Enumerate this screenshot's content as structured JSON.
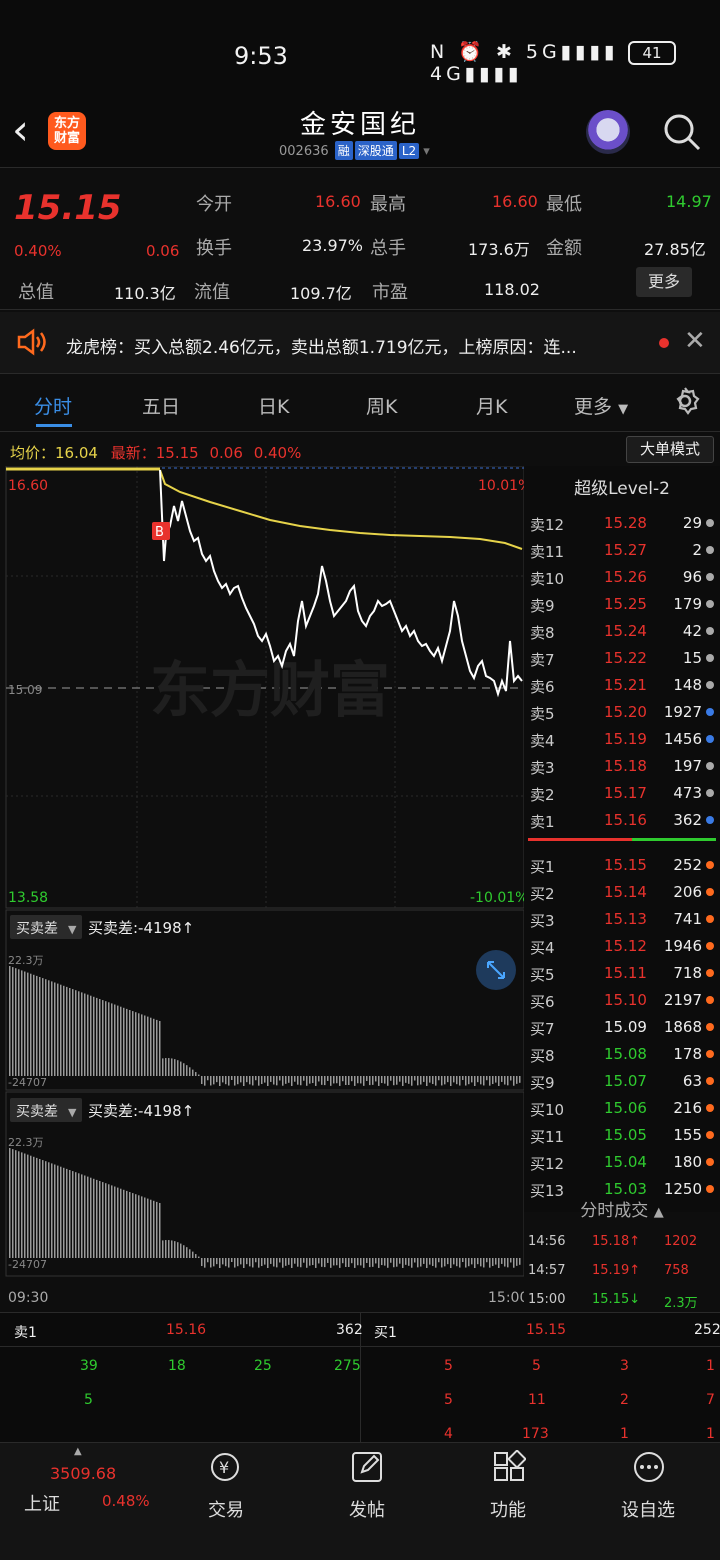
{
  "status": {
    "time": "9:53",
    "battery": "41",
    "icons": "N ⏰ ✱ 5G▮▮▮▮ 4G▮▮▮▮"
  },
  "header": {
    "title": "金安国纪",
    "code": "002636",
    "tags": [
      "融",
      "深股通",
      "L2"
    ],
    "logo": "东方财富"
  },
  "quote": {
    "price": "15.15",
    "change_pct": "0.40%",
    "change": "0.06",
    "jinkai_label": "今开",
    "jinkai": "16.60",
    "zuigao_label": "最高",
    "zuigao": "16.60",
    "zuidi_label": "最低",
    "zuidi": "14.97",
    "huanshou_label": "换手",
    "huanshou": "23.97%",
    "zongshou_label": "总手",
    "zongshou": "173.6万",
    "jine_label": "金额",
    "jine": "27.85亿",
    "zongzhi_label": "总值",
    "zongzhi": "110.3亿",
    "liuzhi_label": "流值",
    "liuzhi": "109.7亿",
    "shiying_label": "市盈",
    "shiying": "118.02",
    "more": "更多"
  },
  "notice": {
    "text": "龙虎榜：买入总额2.46亿元，卖出总额1.719亿元，上榜原因：连..."
  },
  "tabs": [
    "分时",
    "五日",
    "日K",
    "周K",
    "月K",
    "更多"
  ],
  "chart": {
    "avg_label": "均价：",
    "avg": "16.04",
    "latest_label": "最新：",
    "latest": "15.15",
    "latest_change": "0.06",
    "latest_pct": "0.40%",
    "big_order": "大单模式",
    "high_price": "16.60",
    "high_pct": "10.01%",
    "low_price": "13.58",
    "low_pct": "-10.01%",
    "ref_price": "15.09",
    "watermark": "东方财富",
    "sub1_select": "买卖差",
    "sub1_text": "买卖差:-4198↑",
    "sub1_top": "22.3万",
    "sub1_bot": "-24707",
    "sub2_select": "买卖差",
    "sub2_text": "买卖差:-4198↑",
    "sub2_top": "22.3万",
    "sub2_bot": "-24707",
    "time_start": "09:30",
    "time_end": "15:00"
  },
  "orderbook": {
    "title": "超级Level-2",
    "sell": [
      {
        "l": "卖12",
        "p": "15.28",
        "v": "29"
      },
      {
        "l": "卖11",
        "p": "15.27",
        "v": "2"
      },
      {
        "l": "卖10",
        "p": "15.26",
        "v": "96"
      },
      {
        "l": "卖9",
        "p": "15.25",
        "v": "179"
      },
      {
        "l": "卖8",
        "p": "15.24",
        "v": "42"
      },
      {
        "l": "卖7",
        "p": "15.22",
        "v": "15"
      },
      {
        "l": "卖6",
        "p": "15.21",
        "v": "148"
      },
      {
        "l": "卖5",
        "p": "15.20",
        "v": "1927"
      },
      {
        "l": "卖4",
        "p": "15.19",
        "v": "1456"
      },
      {
        "l": "卖3",
        "p": "15.18",
        "v": "197"
      },
      {
        "l": "卖2",
        "p": "15.17",
        "v": "473"
      },
      {
        "l": "卖1",
        "p": "15.16",
        "v": "362"
      }
    ],
    "buy": [
      {
        "l": "买1",
        "p": "15.15",
        "v": "252"
      },
      {
        "l": "买2",
        "p": "15.14",
        "v": "206"
      },
      {
        "l": "买3",
        "p": "15.13",
        "v": "741"
      },
      {
        "l": "买4",
        "p": "15.12",
        "v": "1946"
      },
      {
        "l": "买5",
        "p": "15.11",
        "v": "718"
      },
      {
        "l": "买6",
        "p": "15.10",
        "v": "2197"
      },
      {
        "l": "买7",
        "p": "15.09",
        "v": "1868"
      },
      {
        "l": "买8",
        "p": "15.08",
        "v": "178"
      },
      {
        "l": "买9",
        "p": "15.07",
        "v": "63"
      },
      {
        "l": "买10",
        "p": "15.06",
        "v": "216"
      },
      {
        "l": "买11",
        "p": "15.05",
        "v": "155"
      },
      {
        "l": "买12",
        "p": "15.04",
        "v": "180"
      },
      {
        "l": "买13",
        "p": "15.03",
        "v": "1250"
      }
    ],
    "trades_title": "分时成交",
    "trades": [
      {
        "t": "14:56",
        "p": "15.18↑",
        "v": "1202"
      },
      {
        "t": "14:57",
        "p": "15.19↑",
        "v": "758"
      },
      {
        "t": "15:00",
        "p": "15.15↓",
        "v": "2.3万"
      }
    ]
  },
  "bottom": {
    "sell_label": "卖1",
    "sell_price": "15.16",
    "sell_vol": "362",
    "buy_label": "买1",
    "buy_price": "15.15",
    "buy_vol": "252",
    "left_row1": [
      "39",
      "18",
      "25",
      "275"
    ],
    "left_row2": [
      "5"
    ],
    "right_row1": [
      "5",
      "5",
      "3",
      "1"
    ],
    "right_row2": [
      "5",
      "11",
      "2",
      "7"
    ],
    "right_row3": [
      "4",
      "173",
      "1",
      "1"
    ]
  },
  "nav": {
    "index_value": "3509.68",
    "index_name": "上证",
    "index_pct": "0.48%",
    "trade": "交易",
    "post": "发帖",
    "func": "功能",
    "watch": "设自选"
  }
}
